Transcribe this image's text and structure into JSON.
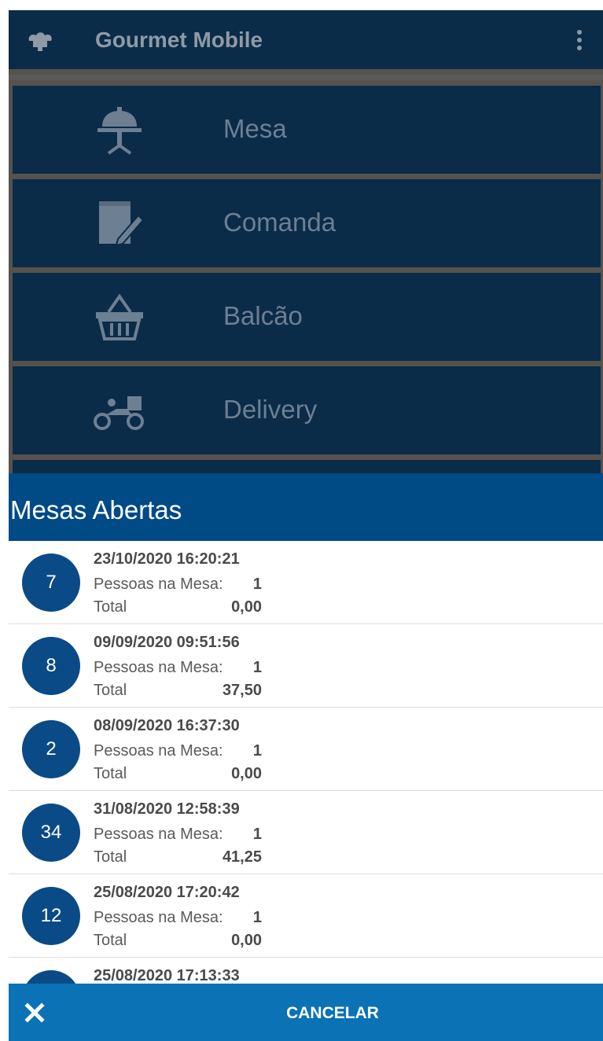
{
  "app": {
    "title": "Gourmet Mobile"
  },
  "menu": [
    {
      "label": "Mesa",
      "icon": "table-cloche-icon"
    },
    {
      "label": "Comanda",
      "icon": "notepad-pen-icon"
    },
    {
      "label": "Balcão",
      "icon": "basket-icon"
    },
    {
      "label": "Delivery",
      "icon": "delivery-scooter-icon"
    }
  ],
  "dialog": {
    "title": "Mesas Abertas",
    "people_label": "Pessoas na Mesa:",
    "total_label": "Total",
    "cancel_label": "CANCELAR",
    "tables": [
      {
        "number": "7",
        "datetime": "23/10/2020 16:20:21",
        "people": "1",
        "total": "0,00"
      },
      {
        "number": "8",
        "datetime": "09/09/2020 09:51:56",
        "people": "1",
        "total": "37,50"
      },
      {
        "number": "2",
        "datetime": "08/09/2020 16:37:30",
        "people": "1",
        "total": "0,00"
      },
      {
        "number": "34",
        "datetime": "31/08/2020 12:58:39",
        "people": "1",
        "total": "41,25"
      },
      {
        "number": "12",
        "datetime": "25/08/2020 17:20:42",
        "people": "1",
        "total": "0,00"
      },
      {
        "number": "",
        "datetime": "25/08/2020 17:13:33",
        "people": "",
        "total": ""
      }
    ]
  },
  "colors": {
    "appbar": "#0a2c48",
    "dialog_header": "#004a86",
    "badge": "#0a4a86",
    "cancel_bar": "#0a72b5"
  }
}
